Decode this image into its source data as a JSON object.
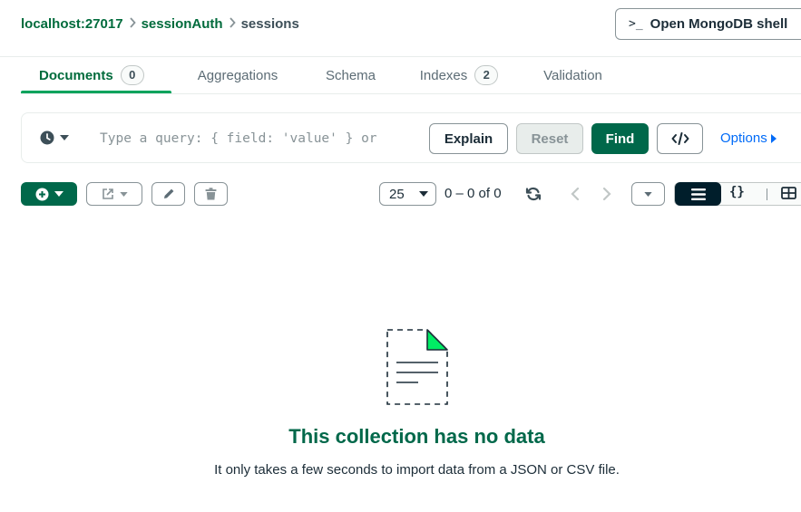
{
  "breadcrumb": {
    "host": "localhost:27017",
    "database": "sessionAuth",
    "collection": "sessions"
  },
  "shell_button": {
    "prompt": ">_",
    "label": "Open MongoDB shell"
  },
  "tabs": [
    {
      "label": "Documents",
      "count": "0",
      "active": true
    },
    {
      "label": "Aggregations"
    },
    {
      "label": "Schema"
    },
    {
      "label": "Indexes",
      "count": "2"
    },
    {
      "label": "Validation"
    }
  ],
  "query_bar": {
    "history_icon": "clock-icon",
    "placeholder": "Type a query: { field: 'value' } or",
    "explain_label": "Explain",
    "reset_label": "Reset",
    "find_label": "Find",
    "code_icon": "code-icon",
    "options_label": "Options"
  },
  "toolbar": {
    "add_icon": "plus-circle-icon",
    "export_icon": "export-icon",
    "edit_icon": "pencil-icon",
    "delete_icon": "trash-icon",
    "page_size": "25",
    "range": "0 – 0 of 0",
    "view_json_label": "{}"
  },
  "empty_state": {
    "title": "This collection has no data",
    "subtitle": "It only takes a few seconds to import data from a JSON or CSV file."
  },
  "colors": {
    "brand_green": "#00684a",
    "accent_green": "#00a35c",
    "link_blue": "#016bf8",
    "dark": "#001e2b"
  }
}
